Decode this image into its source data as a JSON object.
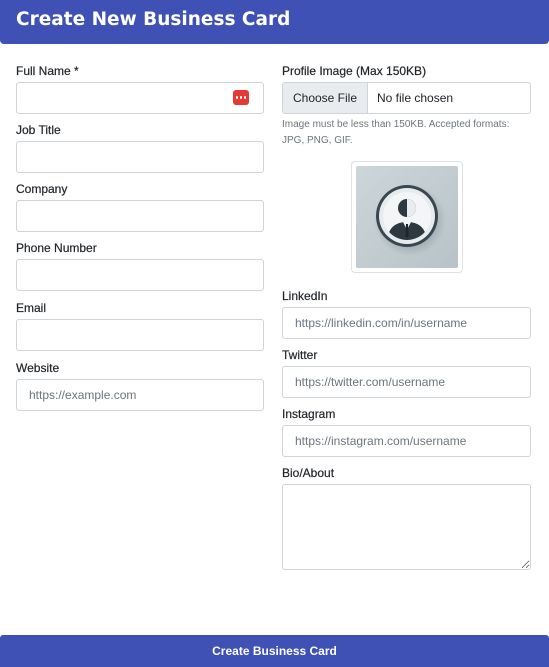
{
  "header": {
    "title": "Create New Business Card"
  },
  "form": {
    "full_name": {
      "label": "Full Name *",
      "value": "",
      "placeholder": ""
    },
    "job_title": {
      "label": "Job Title",
      "value": "",
      "placeholder": ""
    },
    "company": {
      "label": "Company",
      "value": "",
      "placeholder": ""
    },
    "phone": {
      "label": "Phone Number",
      "value": "",
      "placeholder": ""
    },
    "email": {
      "label": "Email",
      "value": "",
      "placeholder": ""
    },
    "website": {
      "label": "Website",
      "value": "",
      "placeholder": "https://example.com"
    },
    "profile_image": {
      "label": "Profile Image (Max 150KB)",
      "button_label": "Choose File",
      "file_status": "No file chosen",
      "help_text": "Image must be less than 150KB. Accepted formats: JPG, PNG, GIF."
    },
    "linkedin": {
      "label": "LinkedIn",
      "value": "",
      "placeholder": "https://linkedin.com/in/username"
    },
    "twitter": {
      "label": "Twitter",
      "value": "",
      "placeholder": "https://twitter.com/username"
    },
    "instagram": {
      "label": "Instagram",
      "value": "",
      "placeholder": "https://instagram.com/username"
    },
    "bio": {
      "label": "Bio/About",
      "value": ""
    }
  },
  "submit": {
    "label": "Create Business Card"
  },
  "icons": {
    "password_manager": "password-manager-icon",
    "profile_placeholder": "user-avatar-icon"
  },
  "colors": {
    "primary": "#3f51b5",
    "border": "#ced4da",
    "help_text": "#6c757d",
    "icon_red": "#e53935"
  }
}
